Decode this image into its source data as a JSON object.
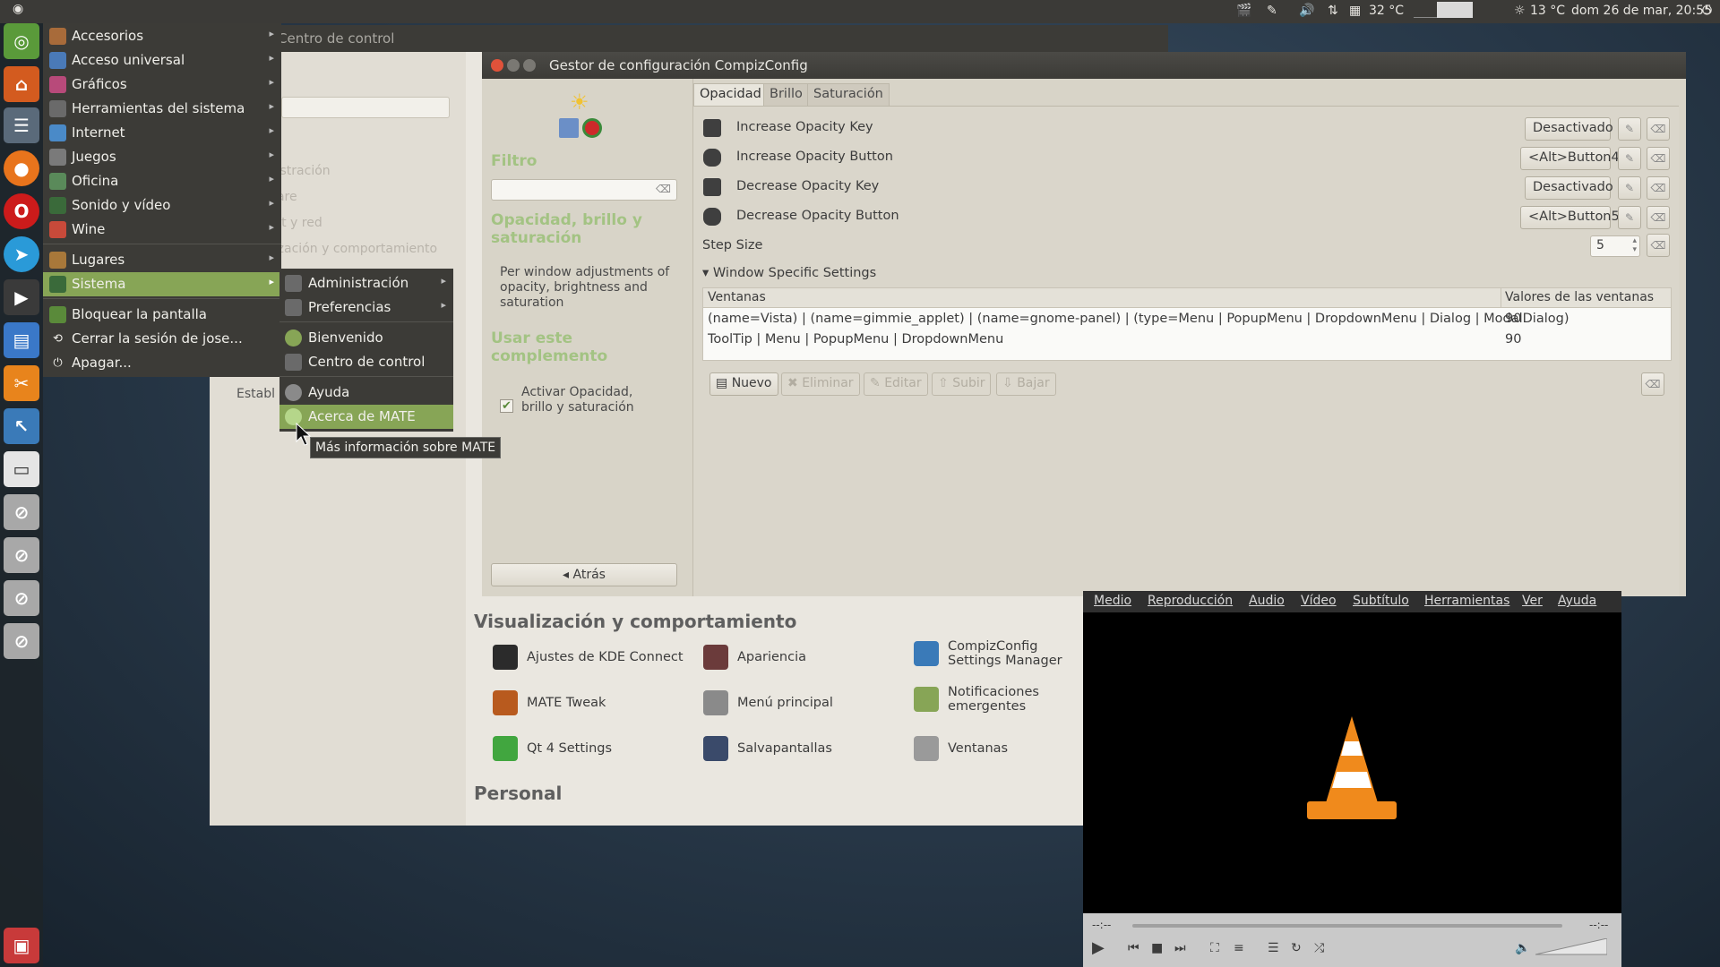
{
  "top_panel": {
    "temperature_cpu": "32 °C",
    "temperature_weather": "13 °C",
    "datetime": "dom 26 de mar, 20:55"
  },
  "control_center": {
    "title": "Centro de control",
    "left_items": [
      "Administración",
      "Hardware",
      "Internet y red",
      "Visualización y comportamiento",
      "Establ"
    ],
    "left_faded": [
      "Administración",
      "Hardware",
      "Internet y red",
      "Visualización y comportamiento",
      "Establ"
    ],
    "section_visual": "Visualización y comportamiento",
    "section_personal": "Personal",
    "items": [
      {
        "label": "Ajustes de KDE Connect",
        "icon": "kde-connect-icon",
        "color": "#2b2b2b"
      },
      {
        "label": "Apariencia",
        "icon": "appearance-icon",
        "color": "#6b3b3b"
      },
      {
        "label": "CompizConfig Settings Manager",
        "icon": "compiz-icon",
        "color": "#3a7ab8"
      },
      {
        "label": "MATE Tweak",
        "icon": "mate-tweak-icon",
        "color": "#b85a1e"
      },
      {
        "label": "Menú principal",
        "icon": "main-menu-icon",
        "color": "#8a8a8a"
      },
      {
        "label": "Notificaciones emergentes",
        "icon": "notification-icon",
        "color": "#87a556"
      },
      {
        "label": "Qt 4 Settings",
        "icon": "qt-icon",
        "color": "#41a63f"
      },
      {
        "label": "Salvapantallas",
        "icon": "screensaver-icon",
        "color": "#3a4a6a"
      },
      {
        "label": "Ventanas",
        "icon": "windows-icon",
        "color": "#9a9a9a"
      }
    ]
  },
  "compiz": {
    "title": "Gestor de configuración CompizConfig",
    "filter_label": "Filtro",
    "plugin_title": "Opacidad, brillo y saturación",
    "plugin_desc": "Per window adjustments of opacity, brightness and saturation",
    "use_plugin_title": "Usar este complemento",
    "activate_label": "Activar Opacidad, brillo y saturación",
    "back_button": "Atrás",
    "tabs": [
      "Opacidad",
      "Brillo",
      "Saturación"
    ],
    "rows": [
      {
        "label": "Increase Opacity Key",
        "value": "Desactivado"
      },
      {
        "label": "Increase Opacity Button",
        "value": "<Alt>Button4"
      },
      {
        "label": "Decrease Opacity Key",
        "value": "Desactivado"
      },
      {
        "label": "Decrease Opacity Button",
        "value": "<Alt>Button5"
      }
    ],
    "step_size_label": "Step Size",
    "step_size_value": "5",
    "window_specific": "Window Specific Settings",
    "table": {
      "headers": [
        "Ventanas",
        "Valores de las ventanas"
      ],
      "rows": [
        [
          "(name=Vista) | (name=gimmie_applet) | (name=gnome-panel) | (type=Menu | PopupMenu | DropdownMenu | Dialog | ModalDialog)",
          "90"
        ],
        [
          "ToolTip | Menu | PopupMenu | DropdownMenu",
          "90"
        ]
      ]
    },
    "buttons": [
      "Nuevo",
      "Eliminar",
      "Editar",
      "Subir",
      "Bajar"
    ]
  },
  "main_menu": {
    "items": [
      {
        "label": "Accesorios",
        "arrow": true,
        "color": "#a86b3a"
      },
      {
        "label": "Acceso universal",
        "arrow": true,
        "color": "#4a7ab8"
      },
      {
        "label": "Gráficos",
        "arrow": true,
        "color": "#b84a7a"
      },
      {
        "label": "Herramientas del sistema",
        "arrow": true,
        "color": "#6a6a6a"
      },
      {
        "label": "Internet",
        "arrow": true,
        "color": "#4a8ac8"
      },
      {
        "label": "Juegos",
        "arrow": true,
        "color": "#7a7a7a"
      },
      {
        "label": "Oficina",
        "arrow": true,
        "color": "#5a8a5a"
      },
      {
        "label": "Sonido y vídeo",
        "arrow": true,
        "color": "#3a6a3a"
      },
      {
        "label": "Wine",
        "arrow": true,
        "color": "#c84a3a"
      },
      {
        "label": "Lugares",
        "arrow": true,
        "color": "#a8783a"
      },
      {
        "label": "Sistema",
        "arrow": true,
        "color": "#3a6a3a"
      },
      {
        "label": "Bloquear la pantalla",
        "arrow": false,
        "color": "#5a8a3a"
      },
      {
        "label": "Cerrar la sesión de jose...",
        "arrow": false,
        "color": "#3c3b37"
      },
      {
        "label": "Apagar...",
        "arrow": false,
        "color": "#3c3b37"
      }
    ]
  },
  "sub_menu": {
    "items": [
      {
        "label": "Administración",
        "arrow": true
      },
      {
        "label": "Preferencias",
        "arrow": true
      },
      {
        "label": "Bienvenido",
        "arrow": false
      },
      {
        "label": "Centro de control",
        "arrow": false
      },
      {
        "label": "Ayuda",
        "arrow": false
      },
      {
        "label": "Acerca de MATE",
        "arrow": false
      }
    ]
  },
  "tooltip": "Más información sobre MATE",
  "vlc": {
    "menu": [
      "Medio",
      "Reproducción",
      "Audio",
      "Vídeo",
      "Subtítulo",
      "Herramientas",
      "Ver",
      "Ayuda"
    ],
    "time_left": "--:--",
    "time_right": "--:--"
  },
  "colors": {
    "accent": "#87a556",
    "menu_bg": "#3c3b37"
  }
}
